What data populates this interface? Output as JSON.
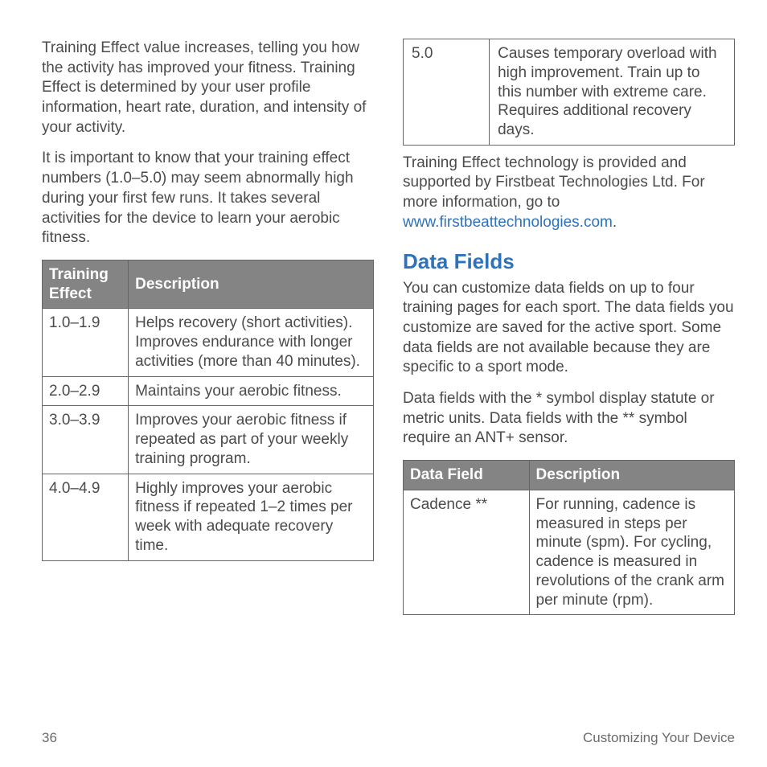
{
  "left": {
    "para1": "Training Effect value increases, telling you how the activity has improved your fitness. Training Effect is determined by your user profile information, heart rate, duration, and intensity of your activity.",
    "para2": "It is important to know that your training effect numbers (1.0–5.0) may seem abnormally high during your first few runs. It takes several activities for the device to learn your aerobic fitness.",
    "table": {
      "head1": "Training Effect",
      "head2": "Description",
      "r0c0": "1.0–1.9",
      "r0c1": "Helps recovery (short activities). Improves endurance with longer activities (more than 40 minutes).",
      "r1c0": "2.0–2.9",
      "r1c1": "Maintains your aerobic fitness.",
      "r2c0": "3.0–3.9",
      "r2c1": "Improves your aerobic fitness if repeated as part of your weekly training program.",
      "r3c0": "4.0–4.9",
      "r3c1": "Highly improves your aerobic fitness if repeated 1–2 times per week with adequate recovery time."
    }
  },
  "right": {
    "top_table": {
      "r0c0": "5.0",
      "r0c1": "Causes temporary overload with high improvement. Train up to this number with extreme care. Requires additional recovery days."
    },
    "after_top_table_pre": "Training Effect technology is provided and supported by Firstbeat Technologies Ltd. For more information, go to ",
    "after_top_table_link": "www.firstbeattechnologies.com",
    "heading": "Data Fields",
    "para1": "You can customize data fields on up to four training pages for each sport. The data fields you customize are saved for the active sport. Some data fields are not available because they are specific to a sport mode.",
    "para2": "Data fields with the * symbol display statute or metric units. Data fields with the ** symbol require an ANT+ sensor.",
    "table": {
      "head1": "Data Field",
      "head2": "Description",
      "r0c0": "Cadence **",
      "r0c1": "For running, cadence is measured in steps per minute (spm). For cycling, cadence is measured in revolutions of the crank arm per minute (rpm)."
    }
  },
  "footer": {
    "page": "36",
    "section": "Customizing Your Device"
  }
}
